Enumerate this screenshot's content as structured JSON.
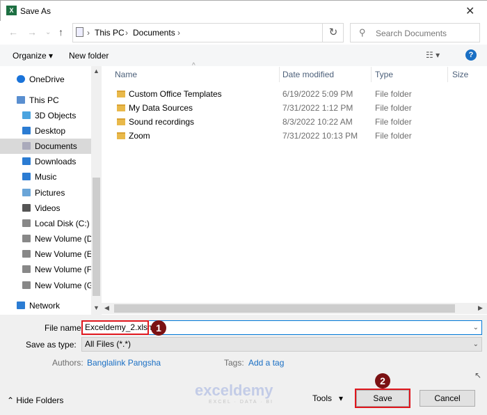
{
  "window": {
    "title": "Save As",
    "app_icon": "excel-icon"
  },
  "address": {
    "crumbs": [
      "This PC",
      "Documents"
    ]
  },
  "search": {
    "placeholder": "Search Documents"
  },
  "toolbar": {
    "organize": "Organize",
    "new_folder": "New folder"
  },
  "sidebar": {
    "items": [
      {
        "label": "OneDrive",
        "icon": "cloud-icon"
      },
      {
        "label": "This PC",
        "icon": "computer-icon"
      },
      {
        "label": "3D Objects",
        "icon": "cube-icon"
      },
      {
        "label": "Desktop",
        "icon": "desktop-icon"
      },
      {
        "label": "Documents",
        "icon": "document-icon",
        "selected": true
      },
      {
        "label": "Downloads",
        "icon": "download-icon"
      },
      {
        "label": "Music",
        "icon": "music-icon"
      },
      {
        "label": "Pictures",
        "icon": "picture-icon"
      },
      {
        "label": "Videos",
        "icon": "video-icon"
      },
      {
        "label": "Local Disk (C:)",
        "icon": "drive-icon"
      },
      {
        "label": "New Volume (D:)",
        "icon": "drive-icon"
      },
      {
        "label": "New Volume (E:)",
        "icon": "drive-icon"
      },
      {
        "label": "New Volume (F:)",
        "icon": "drive-icon"
      },
      {
        "label": "New Volume (G:)",
        "icon": "drive-icon"
      },
      {
        "label": "Network",
        "icon": "network-icon"
      }
    ]
  },
  "columns": [
    "Name",
    "Date modified",
    "Type",
    "Size"
  ],
  "files": [
    {
      "name": "Custom Office Templates",
      "date": "6/19/2022 5:09 PM",
      "type": "File folder"
    },
    {
      "name": "My Data Sources",
      "date": "7/31/2022 1:12 PM",
      "type": "File folder"
    },
    {
      "name": "Sound recordings",
      "date": "8/3/2022 10:22 AM",
      "type": "File folder"
    },
    {
      "name": "Zoom",
      "date": "7/31/2022 10:13 PM",
      "type": "File folder"
    }
  ],
  "form": {
    "file_name_label": "File name:",
    "file_name": "Exceldemy_2.xlsm",
    "type_label": "Save as type:",
    "type_value": "All Files (*.*)",
    "authors_label": "Authors:",
    "authors": "Banglalink Pangsha",
    "tags_label": "Tags:",
    "tags": "Add a tag"
  },
  "footer": {
    "hide_folders": "Hide Folders",
    "tools": "Tools",
    "save": "Save",
    "cancel": "Cancel"
  },
  "annotations": {
    "step1": "1",
    "step2": "2"
  },
  "watermark": {
    "name": "exceldemy",
    "tagline": "EXCEL · DATA · BI"
  },
  "colors": {
    "accent": "#0078d7",
    "highlight": "#e0161d",
    "badge": "#7b1113"
  }
}
